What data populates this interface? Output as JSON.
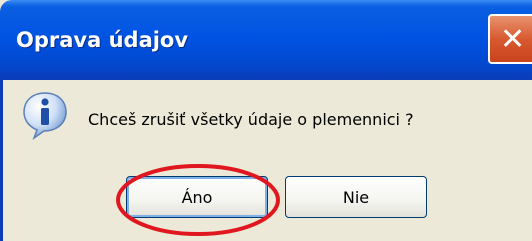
{
  "dialog": {
    "title": "Oprava údajov",
    "close_glyph": "✕",
    "icon": "info-icon",
    "message": "Chceš zrušiť všetky údaje o plemennici ?",
    "buttons": {
      "yes_label": "Áno",
      "no_label": "Nie"
    }
  },
  "annotation": {
    "color": "#e0171f",
    "marks": "yes-button"
  },
  "colors": {
    "titlebar": "#0054e3",
    "background": "#ece9d8",
    "button_border": "#003c74"
  }
}
